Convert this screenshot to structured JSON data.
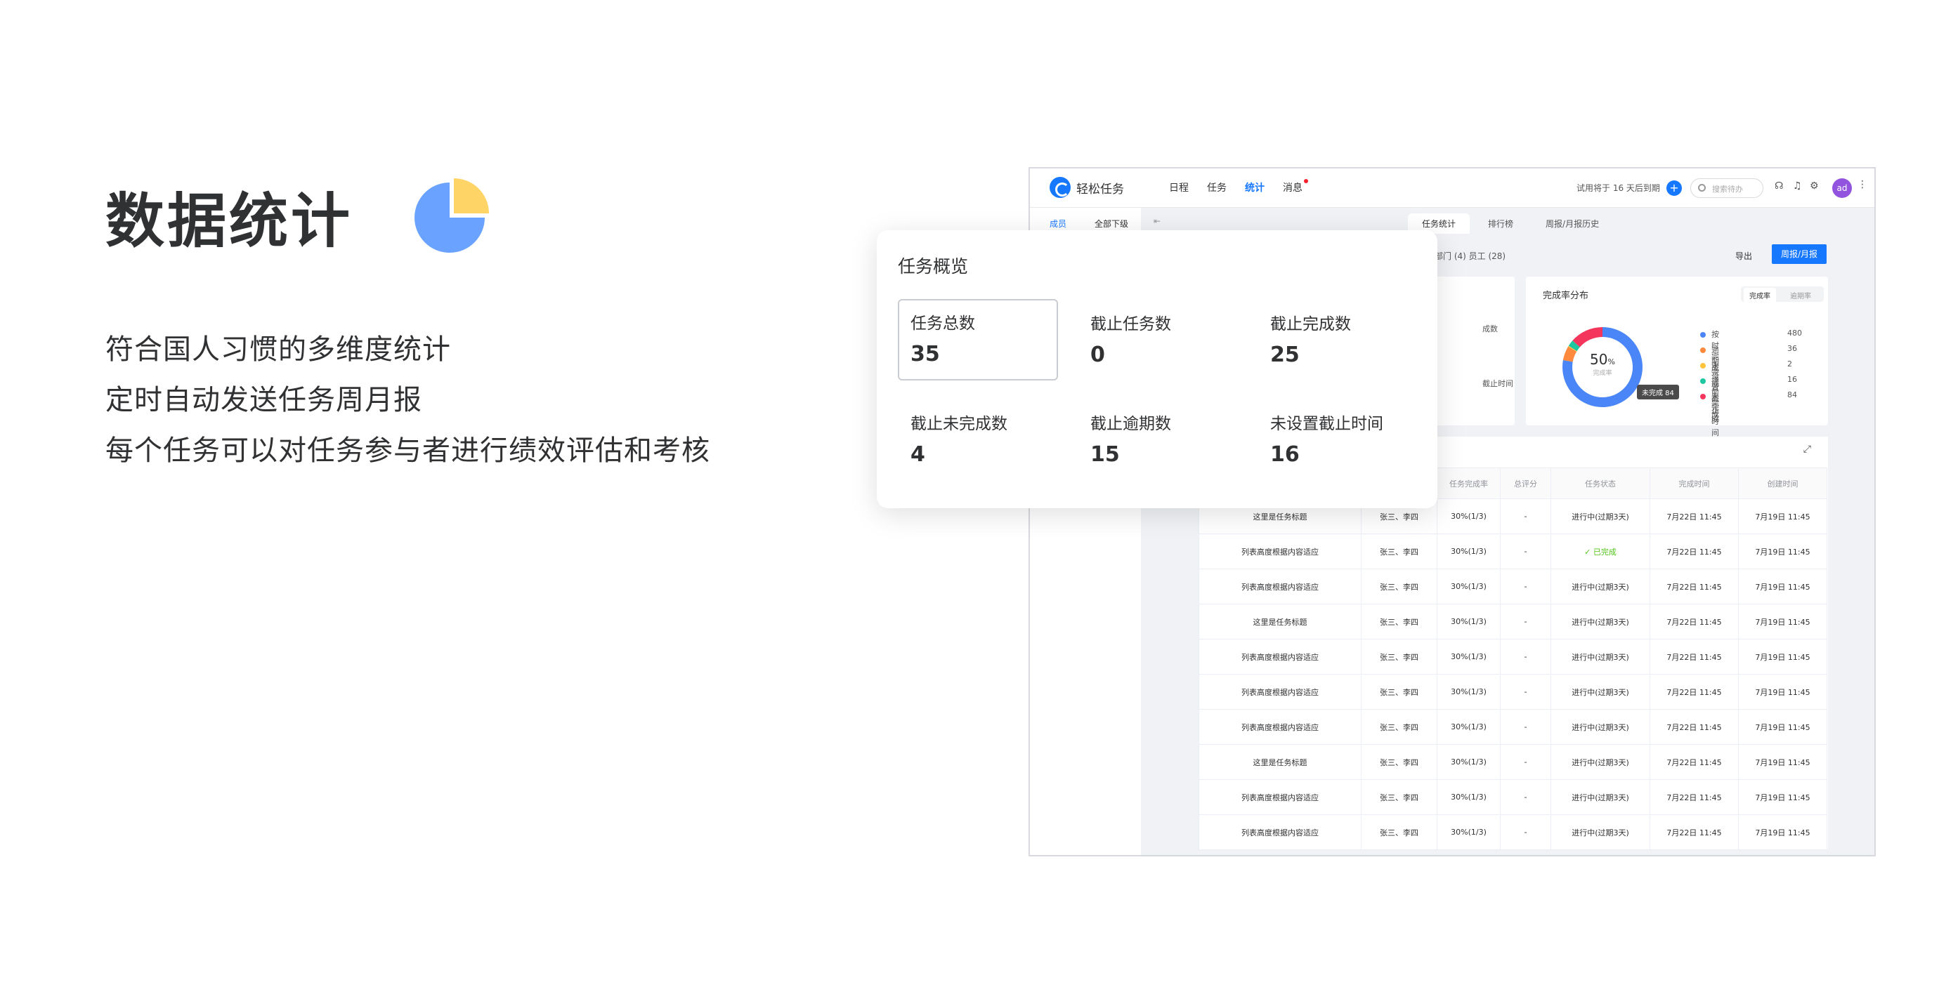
{
  "hero": {
    "title": "数据统计",
    "lines": [
      "符合国人习惯的多维度统计",
      "定时自动发送任务周月报",
      "每个任务可以对任务参与者进行绩效评估和考核"
    ],
    "pie_colors": {
      "main": "#6aa3ff",
      "slice": "#ffd466"
    }
  },
  "app": {
    "brand": "轻松任务",
    "nav": [
      "日程",
      "任务",
      "统计",
      "消息"
    ],
    "active_nav": "统计",
    "trial": "试用将于 16 天后到期",
    "plus": "+",
    "search_placeholder": "搜索待办",
    "avatar": "ad",
    "left_tabs": [
      "成员",
      "全部下级"
    ],
    "tabs": [
      "任务统计",
      "排行榜",
      "周报/月报历史"
    ],
    "subhead": "部门 (4)   员工 (28)",
    "export": "导出",
    "weekly_btn": "周报/月报",
    "left_card_fragments": [
      "成数",
      "截止时间"
    ],
    "accent": "#1677ff"
  },
  "completion": {
    "title": "完成率分布",
    "toggle": [
      "完成率",
      "逾期率"
    ],
    "percent": "50",
    "percent_unit": "%",
    "sub": "完成率",
    "tooltip": "未完成 84",
    "legend": [
      {
        "name": "按时完成",
        "value": 480,
        "color": "#4a86f7"
      },
      {
        "name": "逾期完成",
        "value": 36,
        "color": "#ff8a3d"
      },
      {
        "name": "未设置截止时间",
        "value": 2,
        "color": "#ffc53d"
      },
      {
        "name": "提前完成",
        "value": 16,
        "color": "#1fc7a0"
      },
      {
        "name": "未完成",
        "value": 84,
        "color": "#f5365c"
      }
    ]
  },
  "table": {
    "headers": [
      "",
      "",
      "任务完成率",
      "总评分",
      "任务状态",
      "完成时间",
      "创建时间"
    ],
    "rows": [
      [
        "这里是任务标题",
        "张三、李四",
        "30%(1/3)",
        "-",
        "进行中(过期3天)",
        "7月22日 11:45",
        "7月19日 11:45"
      ],
      [
        "列表高度根据内容适应",
        "张三、李四",
        "30%(1/3)",
        "-",
        "✓ 已完成",
        "7月22日 11:45",
        "7月19日 11:45"
      ],
      [
        "列表高度根据内容适应",
        "张三、李四",
        "30%(1/3)",
        "-",
        "进行中(过期3天)",
        "7月22日 11:45",
        "7月19日 11:45"
      ],
      [
        "这里是任务标题",
        "张三、李四",
        "30%(1/3)",
        "-",
        "进行中(过期3天)",
        "7月22日 11:45",
        "7月19日 11:45"
      ],
      [
        "列表高度根据内容适应",
        "张三、李四",
        "30%(1/3)",
        "-",
        "进行中(过期3天)",
        "7月22日 11:45",
        "7月19日 11:45"
      ],
      [
        "列表高度根据内容适应",
        "张三、李四",
        "30%(1/3)",
        "-",
        "进行中(过期3天)",
        "7月22日 11:45",
        "7月19日 11:45"
      ],
      [
        "列表高度根据内容适应",
        "张三、李四",
        "30%(1/3)",
        "-",
        "进行中(过期3天)",
        "7月22日 11:45",
        "7月19日 11:45"
      ],
      [
        "这里是任务标题",
        "张三、李四",
        "30%(1/3)",
        "-",
        "进行中(过期3天)",
        "7月22日 11:45",
        "7月19日 11:45"
      ],
      [
        "列表高度根据内容适应",
        "张三、李四",
        "30%(1/3)",
        "-",
        "进行中(过期3天)",
        "7月22日 11:45",
        "7月19日 11:45"
      ],
      [
        "列表高度根据内容适应",
        "张三、李四",
        "30%(1/3)",
        "-",
        "进行中(过期3天)",
        "7月22日 11:45",
        "7月19日 11:45"
      ]
    ]
  },
  "overview": {
    "title": "任务概览",
    "items": [
      {
        "label": "任务总数",
        "value": "35"
      },
      {
        "label": "截止任务数",
        "value": "0"
      },
      {
        "label": "截止完成数",
        "value": "25"
      },
      {
        "label": "截止未完成数",
        "value": "4"
      },
      {
        "label": "截止逾期数",
        "value": "15"
      },
      {
        "label": "未设置截止时间",
        "value": "16"
      }
    ]
  }
}
